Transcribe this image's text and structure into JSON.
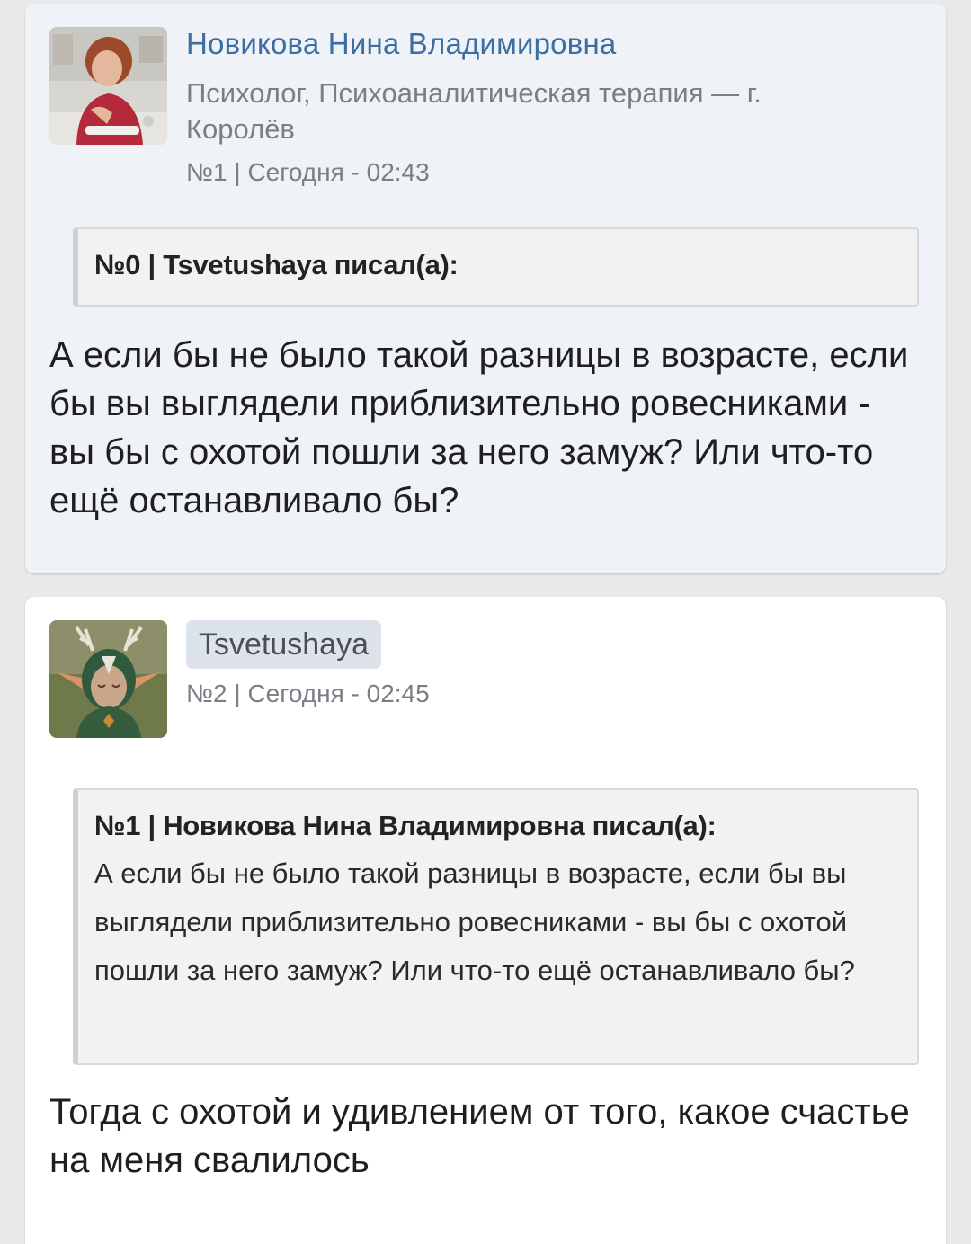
{
  "posts": [
    {
      "author": {
        "name": "Новикова Нина Владимировна",
        "role": "Психолог, Психоаналитическая терапия — г. Королёв",
        "avatar_icon": "avatar-photo-woman"
      },
      "meta": "№1 | Сегодня - 02:43",
      "quote": {
        "header": "№0 | Tsvetushaya писал(а):",
        "text": ""
      },
      "body": "А если бы не было такой разницы в возрасте, если бы вы выглядели приблизительно ровесниками - вы бы с охотой пошли за него замуж? Или что-то ещё останавливало бы?"
    },
    {
      "author": {
        "name": "Tsvetushaya",
        "avatar_icon": "avatar-forest-spirit"
      },
      "meta": "№2 | Сегодня - 02:45",
      "quote": {
        "header": "№1 | Новикова Нина Владимировна писал(а):",
        "text": "А если бы не было такой разницы в возрасте, если бы вы выглядели приблизительно ровесниками - вы бы с охотой пошли за него замуж? Или что-то ещё останавливало бы?"
      },
      "body": "Тогда с охотой и удивлением от того, какое счастье на меня свалилось"
    }
  ],
  "colors": {
    "page_bg": "#e9e9e9",
    "card1_bg": "#eff2f6",
    "card2_bg": "#ffffff",
    "author_link": "#3c6da3",
    "meta_text": "#7a7f86",
    "quote_bg": "#f2f2f2",
    "chip_bg": "#dde3ea"
  }
}
